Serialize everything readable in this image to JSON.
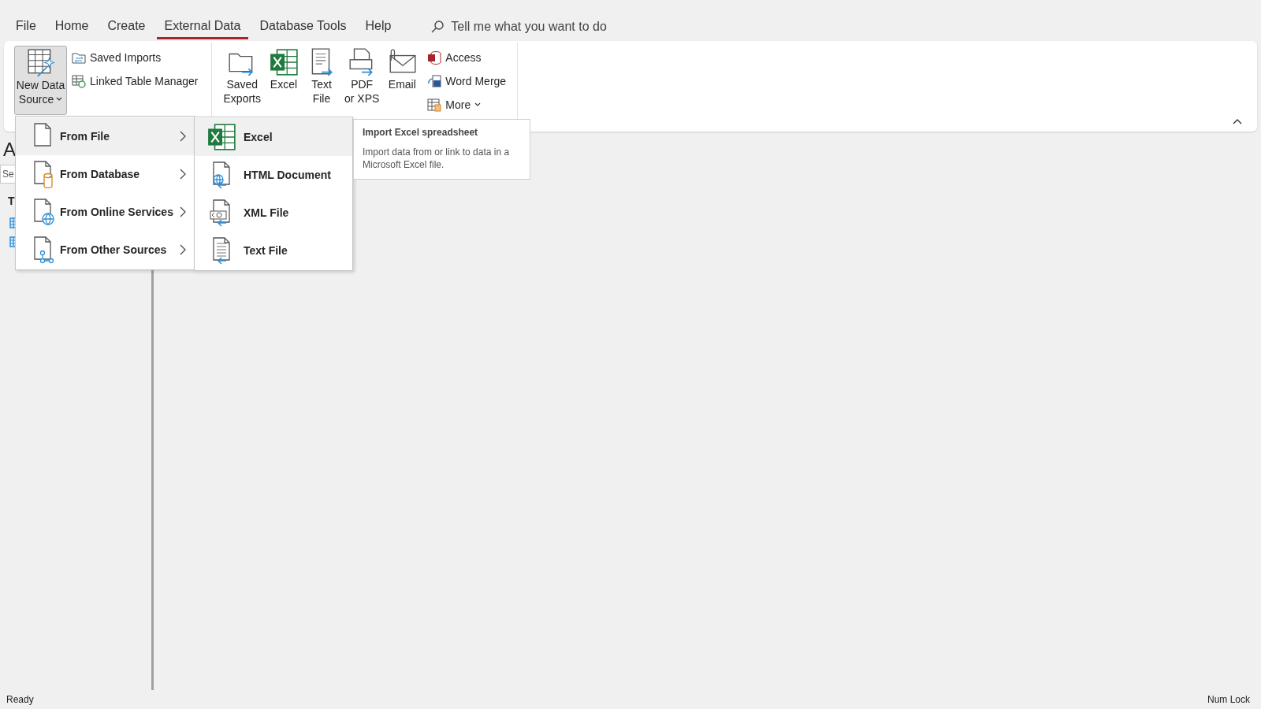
{
  "tabs": [
    {
      "label": "File",
      "selected": false
    },
    {
      "label": "Home",
      "selected": false
    },
    {
      "label": "Create",
      "selected": false
    },
    {
      "label": "External Data",
      "selected": true
    },
    {
      "label": "Database Tools",
      "selected": false
    },
    {
      "label": "Help",
      "selected": false
    }
  ],
  "tell_me": {
    "placeholder": "Tell me what you want to do"
  },
  "ribbon": {
    "new_data_source": {
      "line1": "New Data",
      "line2": "Source",
      "expanded": true
    },
    "import_items": [
      {
        "kind": "saved",
        "label": "Saved Imports"
      },
      {
        "kind": "linked",
        "label": "Linked Table Manager"
      }
    ],
    "export_buttons": [
      {
        "kind": "saved",
        "line1": "Saved",
        "line2": "Exports"
      },
      {
        "kind": "excel",
        "line1": "Excel"
      },
      {
        "kind": "text",
        "line1": "Text",
        "line2": "File"
      },
      {
        "kind": "pdf",
        "line1": "PDF",
        "line2": "or XPS"
      },
      {
        "kind": "email",
        "line1": "Email"
      }
    ],
    "export_small": [
      {
        "kind": "access",
        "label": "Access",
        "dropdown": false
      },
      {
        "kind": "word",
        "label": "Word Merge",
        "dropdown": false
      },
      {
        "kind": "more",
        "label": "More",
        "dropdown": true
      }
    ]
  },
  "nav_pane": {
    "title": "A",
    "search": {
      "placeholder": "Se"
    },
    "group": "T"
  },
  "source_menu": [
    {
      "kind": "file",
      "label": "From File",
      "selected": true
    },
    {
      "kind": "database",
      "label": "From Database",
      "selected": false
    },
    {
      "kind": "online",
      "label": "From Online Services",
      "selected": false
    },
    {
      "kind": "other",
      "label": "From Other Sources",
      "selected": false
    }
  ],
  "file_menu": [
    {
      "kind": "excel",
      "label": "Excel",
      "selected": true
    },
    {
      "kind": "html",
      "label": "HTML Document",
      "selected": false
    },
    {
      "kind": "xml",
      "label": "XML File",
      "selected": false
    },
    {
      "kind": "text",
      "label": "Text File",
      "selected": false
    }
  ],
  "tooltip": {
    "title": "Import Excel spreadsheet",
    "text": "Import data from or link to data in a Microsoft Excel file."
  },
  "status_bar": {
    "left": "Ready",
    "right": "Num Lock"
  }
}
